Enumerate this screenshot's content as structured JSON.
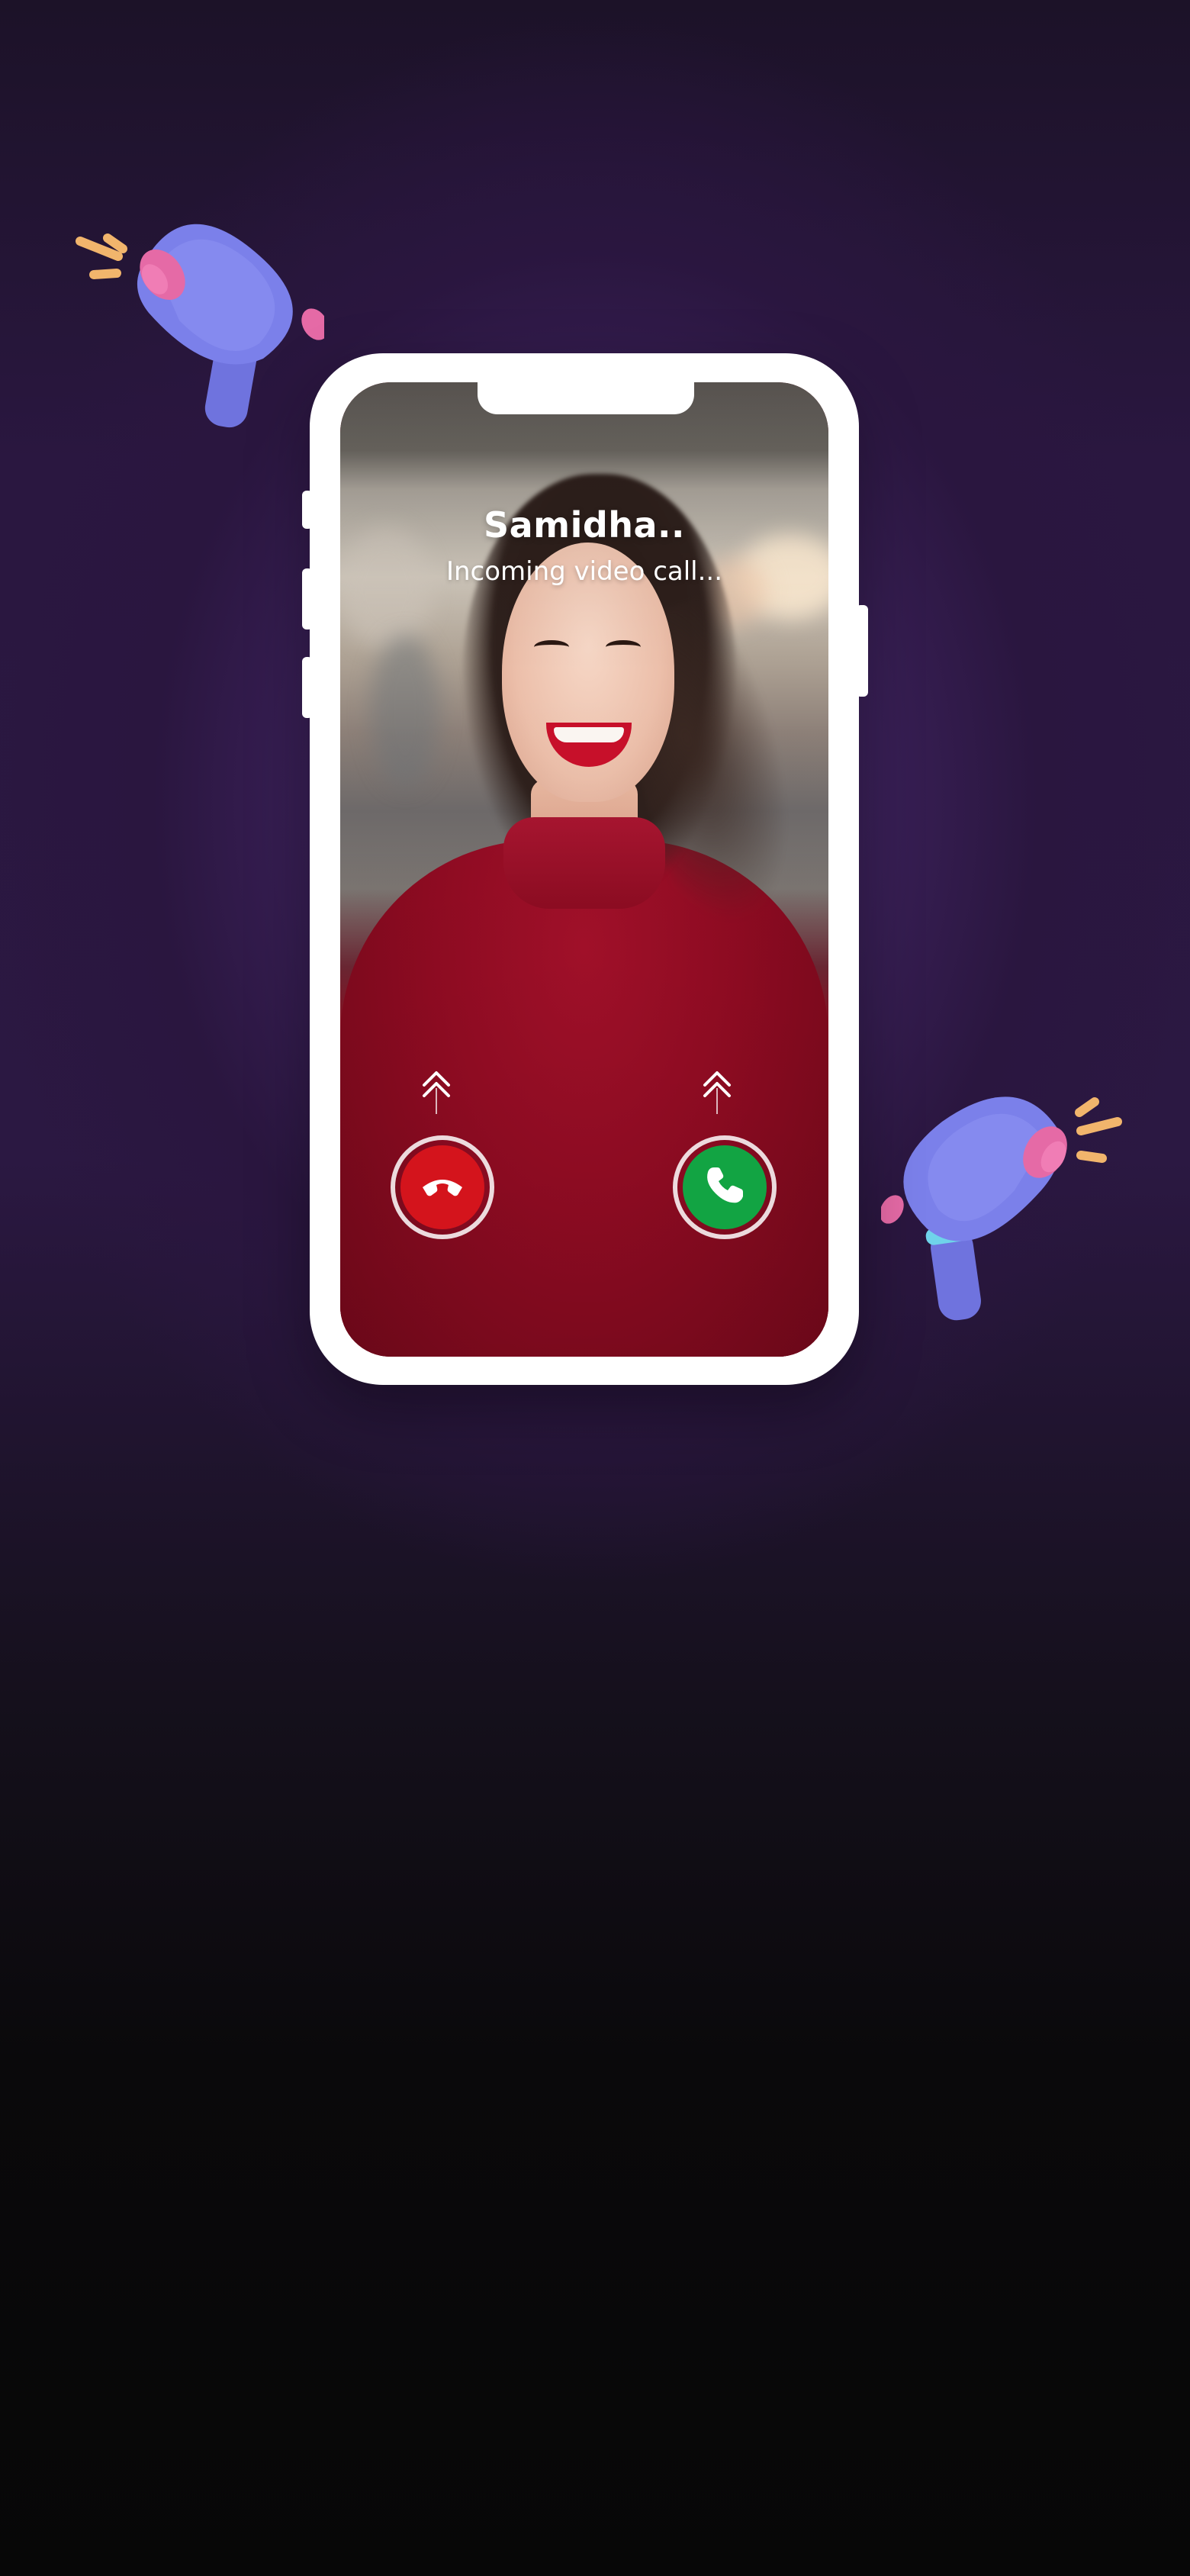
{
  "call": {
    "caller_name": "Samidha..",
    "status": "Incoming video call..."
  },
  "actions": {
    "decline": {
      "icon": "phone-hangup-icon",
      "color": "#d4141c"
    },
    "accept": {
      "icon": "phone-icon",
      "color": "#12a443"
    }
  },
  "decorations": {
    "megaphone_color": "#7b80ea",
    "accent_pink": "#e56aa6",
    "accent_cyan": "#6fd3ea",
    "spark_color": "#f1b56c"
  }
}
